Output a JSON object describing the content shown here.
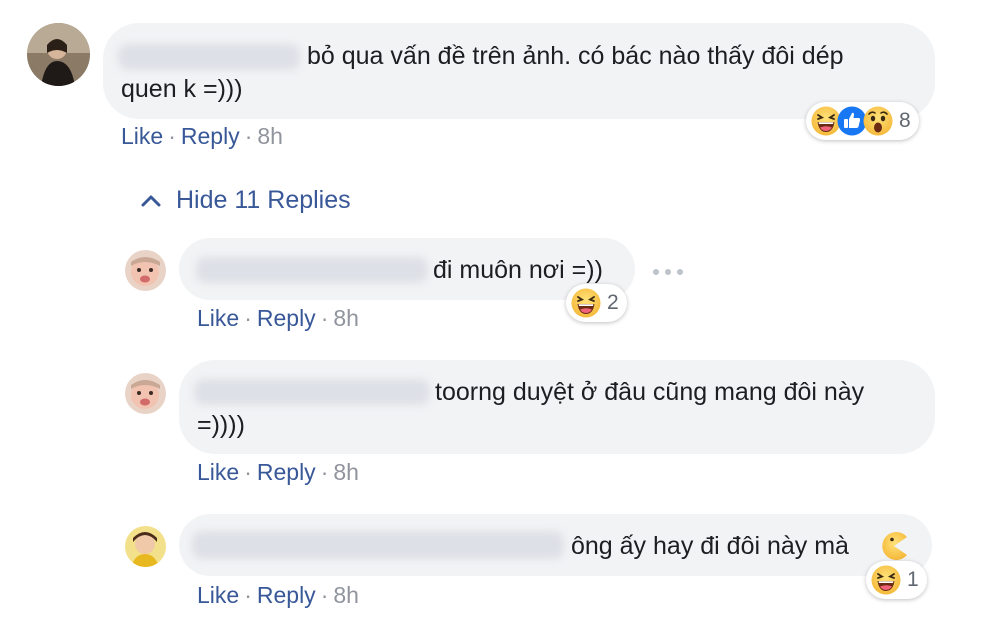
{
  "comments": [
    {
      "text_line1": "bỏ qua vấn đề trên ảnh. có bác nào thấy đôi dép",
      "text_line2": "quen k =)))",
      "like": "Like",
      "reply": "Reply",
      "time": "8h",
      "reactions": [
        "laughing-face",
        "like-thumb",
        "surprised-face"
      ],
      "reaction_count": "8"
    }
  ],
  "hide_replies_label": "Hide 11 Replies",
  "replies": [
    {
      "text": "đi muôn nơi =))",
      "like": "Like",
      "reply": "Reply",
      "time": "8h",
      "reactions": [
        "laughing-face"
      ],
      "reaction_count": "2"
    },
    {
      "text_line1": "toorng duyệt ở đâu cũng mang đôi này",
      "text_line2": "=))))",
      "like": "Like",
      "reply": "Reply",
      "time": "8h"
    },
    {
      "text": "ông ấy hay đi đôi này mà",
      "like": "Like",
      "reply": "Reply",
      "time": "8h",
      "inline_emoji": "pacman-emoji",
      "reactions": [
        "laughing-face"
      ],
      "reaction_count": "1"
    }
  ],
  "colors": {
    "link": "#385898",
    "muted": "#90949c",
    "bubble": "#f2f3f5",
    "text": "#1c1e21",
    "like_blue": "#1877f2",
    "emoji_yellow": "#fcd462"
  }
}
